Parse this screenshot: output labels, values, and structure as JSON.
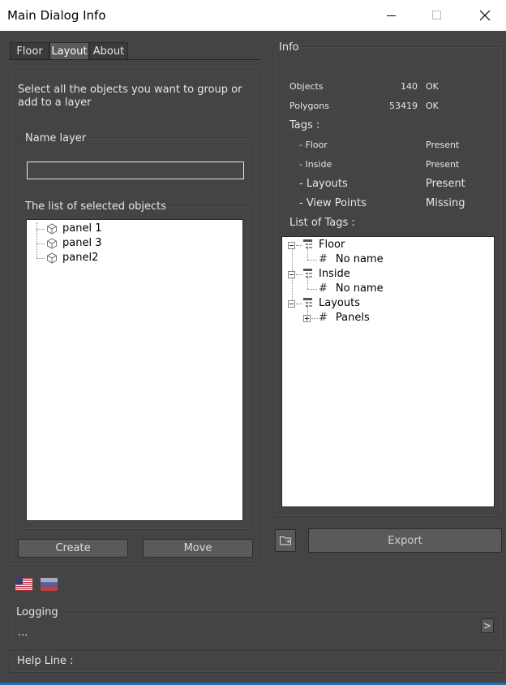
{
  "window": {
    "title": "Main Dialog Info"
  },
  "tabs": [
    {
      "label": "Floor"
    },
    {
      "label": "Layout",
      "active": true
    },
    {
      "label": "About"
    }
  ],
  "layout_tab": {
    "instructions_line1": "Select all the objects you want to group or",
    "instructions_line2": "add to a layer",
    "name_layer_title": "Name layer",
    "name_layer_value": "",
    "selected_list_title": "The list of selected objects",
    "selected_objects": [
      "panel 1",
      "panel 3",
      "panel2"
    ],
    "create_label": "Create",
    "move_label": "Move"
  },
  "info": {
    "title": "Info",
    "objects_label": "Objects",
    "objects_count": "140",
    "objects_status": "OK",
    "polygons_label": "Polygons",
    "polygons_count": "53419",
    "polygons_status": "OK",
    "tags_label": "Tags :",
    "tags": [
      {
        "name": "- Floor",
        "status": "Present"
      },
      {
        "name": "- Inside",
        "status": "Present"
      },
      {
        "name": "- Layouts",
        "status": "Present"
      },
      {
        "name": "- View Points",
        "status": "Missing"
      }
    ],
    "list_of_tags_label": "List of Tags :",
    "tag_tree": [
      {
        "label": "Floor",
        "child": "No name"
      },
      {
        "label": "Inside",
        "child": "No name"
      },
      {
        "label": "Layouts",
        "child": "Panels"
      }
    ],
    "export_label": "Export"
  },
  "languages": [
    "en-flag-icon",
    "ru-flag-icon"
  ],
  "logging": {
    "title": "Logging",
    "text": "...",
    "expand_label": ">"
  },
  "help_line": {
    "label": "Help Line :"
  },
  "colors": {
    "background": "#444444",
    "titlebar": "#ffffff",
    "button": "#5a5a5a"
  }
}
